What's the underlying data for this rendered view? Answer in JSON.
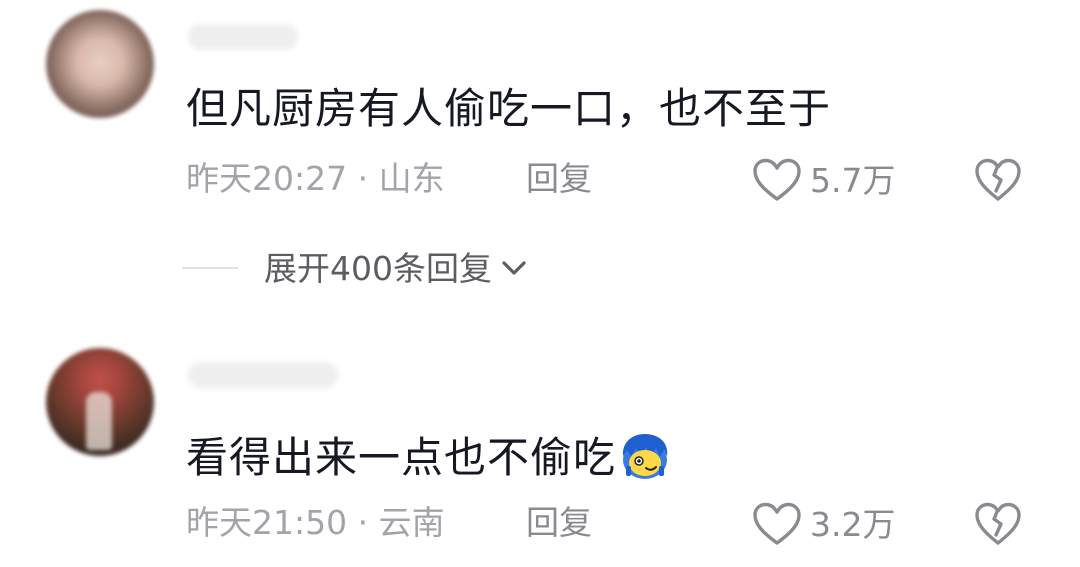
{
  "colors": {
    "primary_text": "#161823",
    "secondary_text": "#a3a4aa",
    "action_text": "#8a8b91",
    "expand_text": "#5c5d63",
    "background": "#ffffff"
  },
  "comments": [
    {
      "text": "但凡厨房有人偷吃一口，也不至于",
      "meta": "昨天20:27 · 山东",
      "reply_label": "回复",
      "likes": "5.7万",
      "avatar_icon": "avatar-icon",
      "like_icon": "heart-outline-icon",
      "dislike_icon": "broken-heart-icon"
    },
    {
      "text": "看得出来一点也不偷吃",
      "emoji_icon": "embarrassed-emoji-icon",
      "meta": "昨天21:50 · 云南",
      "reply_label": "回复",
      "likes": "3.2万",
      "avatar_icon": "avatar-icon",
      "like_icon": "heart-outline-icon",
      "dislike_icon": "broken-heart-icon"
    }
  ],
  "expand_replies": {
    "label": "展开400条回复",
    "icon": "chevron-down-icon"
  }
}
